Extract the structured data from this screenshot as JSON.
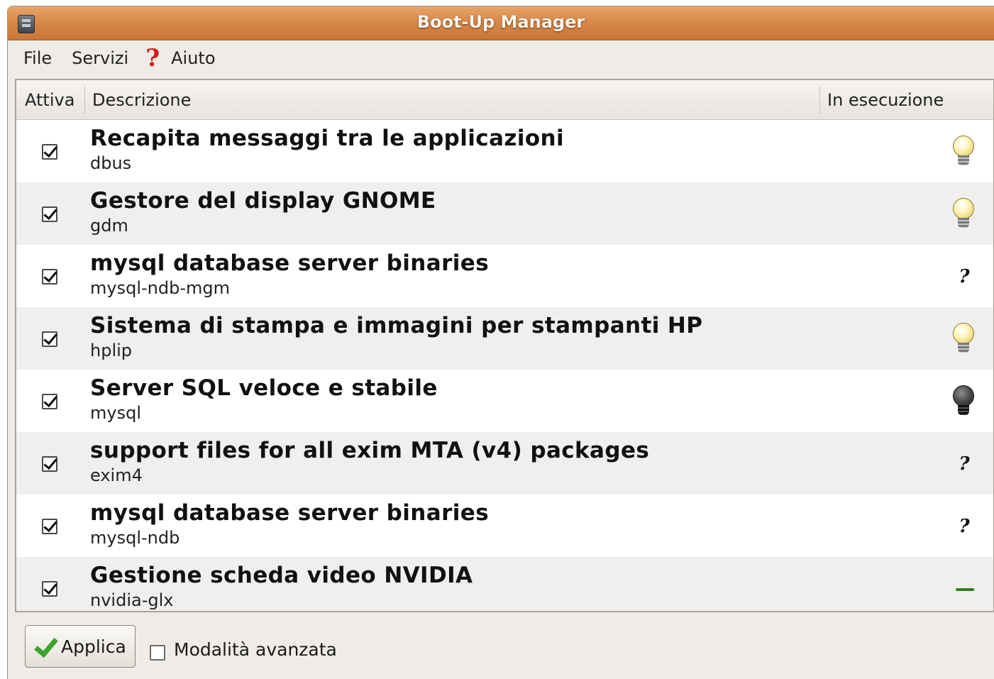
{
  "window": {
    "title": "Boot-Up Manager"
  },
  "menu": {
    "file": "File",
    "services": "Servizi",
    "help": "Aiuto"
  },
  "columns": {
    "active": "Attiva",
    "description": "Descrizione",
    "running": "In esecuzione"
  },
  "services": [
    {
      "name": "Recapita messaggi tra le applicazioni",
      "pkg": "dbus",
      "active": true,
      "status": "running"
    },
    {
      "name": "Gestore del display GNOME",
      "pkg": "gdm",
      "active": true,
      "status": "running"
    },
    {
      "name": "mysql database server binaries",
      "pkg": "mysql-ndb-mgm",
      "active": true,
      "status": "unknown",
      "status_text": "?"
    },
    {
      "name": "Sistema di stampa e immagini per stampanti HP",
      "pkg": "hplip",
      "active": true,
      "status": "running"
    },
    {
      "name": "Server SQL veloce e stabile",
      "pkg": "mysql",
      "active": true,
      "status": "stopped"
    },
    {
      "name": "support files for all exim MTA (v4) packages",
      "pkg": "exim4",
      "active": true,
      "status": "unknown",
      "status_text": "?"
    },
    {
      "name": "mysql database server binaries",
      "pkg": "mysql-ndb",
      "active": true,
      "status": "unknown",
      "status_text": "?"
    },
    {
      "name": "Gestione scheda video NVIDIA",
      "pkg": "nvidia-glx",
      "active": true,
      "status": "none"
    }
  ],
  "footer": {
    "apply": "Applica",
    "advanced_mode": "Modalità avanzata",
    "advanced_checked": false
  },
  "icons": {
    "window": "app-icon",
    "help": "help-icon",
    "running": "lightbulb-on-icon",
    "stopped": "lightbulb-off-icon",
    "unknown": "question-icon",
    "none": "dash-icon",
    "apply": "check-icon"
  },
  "colors": {
    "titlebar": "#d78a4a",
    "help_icon": "#d41b1b",
    "apply_check": "#3aa52b",
    "dash": "#2e7d22"
  }
}
